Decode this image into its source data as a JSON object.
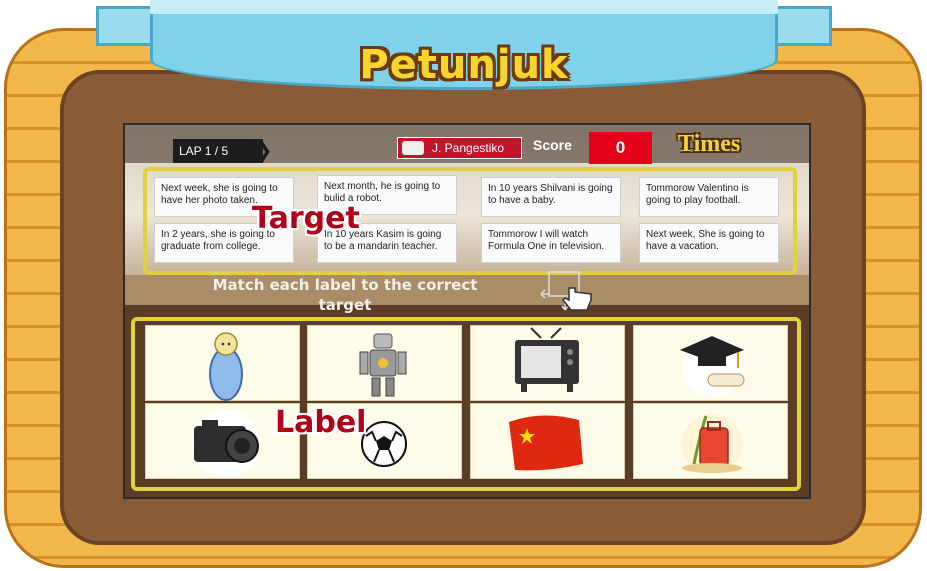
{
  "header": {
    "title": "Petunjuk"
  },
  "hud": {
    "lap": "LAP 1 / 5",
    "player": "J. Pangestiko",
    "score_label": "Score",
    "score": "0",
    "times_label": "Times"
  },
  "target_cards": [
    "Next week, she is going to have her photo taken.",
    "Next month, he is going to bulid a robot.",
    "In 10 years Shilvani is going to have a baby.",
    "Tommorow Valentino is going to play football.",
    "In 2 years, she is going to graduate from college.",
    "In 10 years Kasim is going to be a mandarin teacher.",
    "Tommorow I will watch Formula One in television.",
    "Next week, She is going to have a vacation."
  ],
  "overlays": {
    "target": "Target",
    "label": "Label"
  },
  "instruction": "Match each label to the correct target",
  "label_icons": [
    "baby-icon",
    "robot-icon",
    "television-icon",
    "graduation-cap-icon",
    "camera-icon",
    "football-icon",
    "china-flag-icon",
    "suitcase-icon"
  ],
  "colors": {
    "accent_red": "#e4001b",
    "outline_yellow": "#e2d23a",
    "title_yellow": "#f7d52c",
    "ribbon_blue": "#7fd2ea"
  }
}
